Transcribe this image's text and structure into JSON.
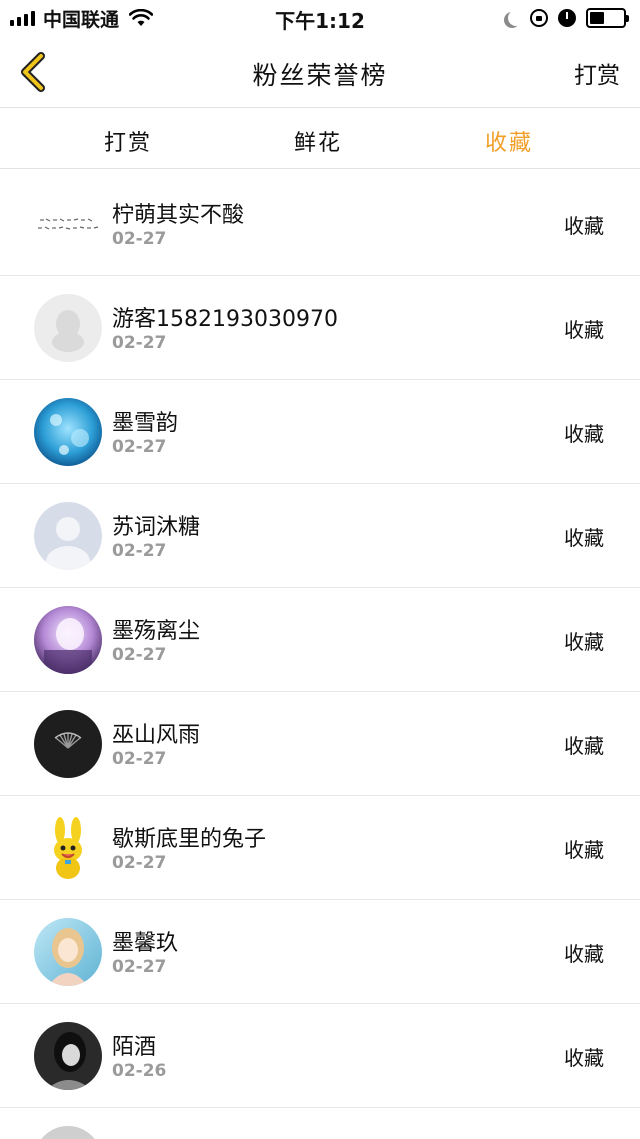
{
  "status_bar": {
    "carrier": "中国联通",
    "time": "下午1:12"
  },
  "nav": {
    "title": "粉丝荣誉榜",
    "action": "打赏"
  },
  "tabs": [
    {
      "label": "打赏",
      "active": false
    },
    {
      "label": "鲜花",
      "active": false
    },
    {
      "label": "收藏",
      "active": true
    }
  ],
  "accent_color": "#f3a02a",
  "fans": [
    {
      "name": "柠萌其实不酸",
      "date": "02-27",
      "action": "收藏",
      "avatar": "calligraphy-text"
    },
    {
      "name": "游客1582193030970",
      "date": "02-27",
      "action": "收藏",
      "avatar": "default-penguin"
    },
    {
      "name": "墨雪韵",
      "date": "02-27",
      "action": "收藏",
      "avatar": "anime-blue"
    },
    {
      "name": "苏词沐糖",
      "date": "02-27",
      "action": "收藏",
      "avatar": "default-person"
    },
    {
      "name": "墨殇离尘",
      "date": "02-27",
      "action": "收藏",
      "avatar": "anime-purple"
    },
    {
      "name": "巫山风雨",
      "date": "02-27",
      "action": "收藏",
      "avatar": "dark-fan"
    },
    {
      "name": "歇斯底里的兔子",
      "date": "02-27",
      "action": "收藏",
      "avatar": "yellow-rabbit"
    },
    {
      "name": "墨馨玖",
      "date": "02-27",
      "action": "收藏",
      "avatar": "anime-girl"
    },
    {
      "name": "陌酒",
      "date": "02-26",
      "action": "收藏",
      "avatar": "bw-girl"
    }
  ]
}
